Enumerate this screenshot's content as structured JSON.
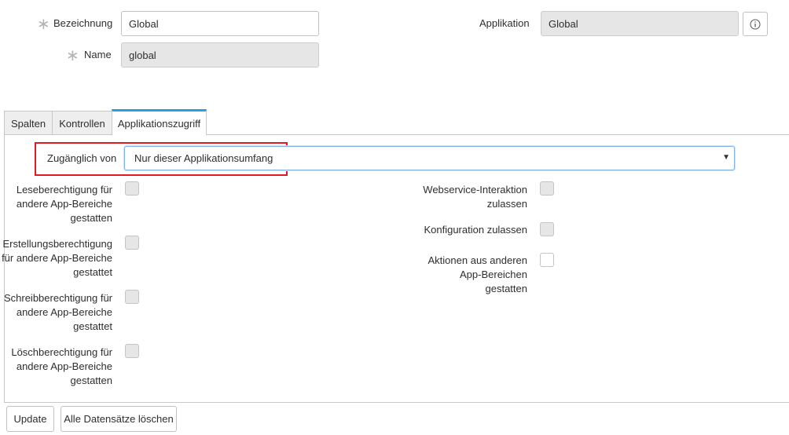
{
  "form": {
    "bezeichnung": {
      "label": "Bezeichnung",
      "value": "Global"
    },
    "name": {
      "label": "Name",
      "value": "global"
    },
    "applikation": {
      "label": "Applikation",
      "value": "Global"
    },
    "required_mark": "∗",
    "info_icon": "ⓘ"
  },
  "tabs": [
    {
      "label": "Spalten"
    },
    {
      "label": "Kontrollen"
    },
    {
      "label": "Applikationszugriff",
      "active": true
    }
  ],
  "access": {
    "zugaenglich_label": "Zugänglich von",
    "zugaenglich_value": "Nur dieser Applikationsumfang",
    "caret": "▼",
    "left": [
      {
        "line1": "Leseberechtigung für",
        "line2": "andere App-Bereiche",
        "line3": "gestatten",
        "checked": false
      },
      {
        "line1": "Erstellungsberechtigung",
        "line2": "für andere App-Bereiche",
        "line3": "gestattet",
        "checked": false
      },
      {
        "line1": "Schreibberechtigung für",
        "line2": "andere App-Bereiche",
        "line3": "gestattet",
        "checked": false
      },
      {
        "line1": "Löschberechtigung für",
        "line2": "andere App-Bereiche",
        "line3": "gestatten",
        "checked": false
      }
    ],
    "right": [
      {
        "line1": "Webservice-Interaktion",
        "line2": "zulassen",
        "checked": false
      },
      {
        "line1": "Konfiguration zulassen",
        "checked": false
      },
      {
        "line1": "Aktionen aus anderen",
        "line2": "App-Bereichen",
        "line3": "gestatten",
        "checked": false
      }
    ]
  },
  "actions": {
    "update": "Update",
    "delete_all": "Alle Datensätze löschen"
  },
  "colors": {
    "tab_active_accent": "#2b9fd8",
    "highlight_box": "#e01b22",
    "readonly_bg": "#e6e6e6"
  }
}
